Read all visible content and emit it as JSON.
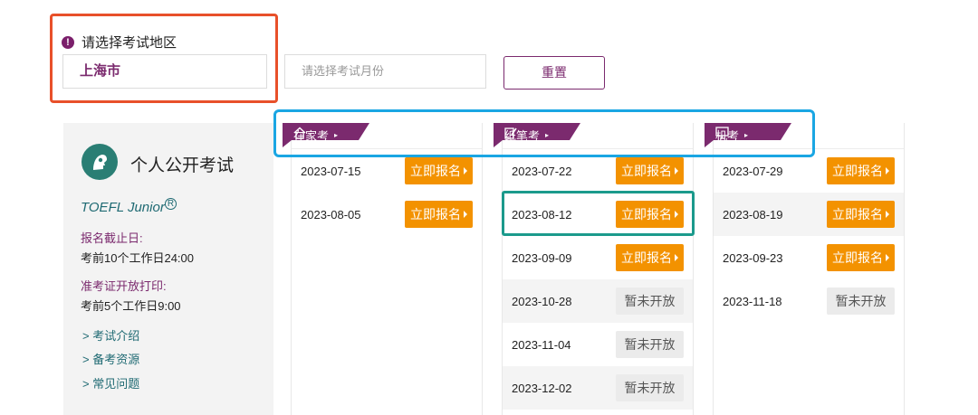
{
  "filters": {
    "region_label": "请选择考试地区",
    "region_value": "上海市",
    "month_placeholder": "请选择考试月份",
    "reset_label": "重置"
  },
  "exam_info": {
    "title": "个人公开考试",
    "product": "TOEFL Junior",
    "product_mark": "R",
    "deadline_label": "报名截止日:",
    "deadline_value": "考前10个工作日24:00",
    "ticket_label": "准考证开放打印:",
    "ticket_value": "考前5个工作日9:00",
    "links": [
      "> 考试介绍",
      "> 备考资源",
      "> 常见问题"
    ]
  },
  "columns": [
    {
      "tab": "在家考",
      "icon": "home-icon",
      "rows": [
        {
          "date": "2023-07-15",
          "status": "立即报名",
          "open": true
        },
        {
          "date": "2023-08-05",
          "status": "立即报名",
          "open": true
        }
      ]
    },
    {
      "tab": "纸笔考",
      "icon": "paper-pen-icon",
      "rows": [
        {
          "date": "2023-07-22",
          "status": "立即报名",
          "open": true
        },
        {
          "date": "2023-08-12",
          "status": "立即报名",
          "open": true
        },
        {
          "date": "2023-09-09",
          "status": "立即报名",
          "open": true
        },
        {
          "date": "2023-10-28",
          "status": "暂未开放",
          "open": false
        },
        {
          "date": "2023-11-04",
          "status": "暂未开放",
          "open": false
        },
        {
          "date": "2023-12-02",
          "status": "暂未开放",
          "open": false
        }
      ]
    },
    {
      "tab": "机考",
      "icon": "monitor-icon",
      "rows": [
        {
          "date": "2023-07-29",
          "status": "立即报名",
          "open": true
        },
        {
          "date": "2023-08-19",
          "status": "立即报名",
          "open": true
        },
        {
          "date": "2023-09-23",
          "status": "立即报名",
          "open": true
        },
        {
          "date": "2023-11-18",
          "status": "暂未开放",
          "open": false
        }
      ]
    }
  ],
  "colors": {
    "brand_purple": "#7b2a6e",
    "register_orange": "#f39200",
    "annotation_red": "#e8502a",
    "annotation_blue": "#1aa6e3",
    "annotation_green": "#1b9a8c"
  }
}
